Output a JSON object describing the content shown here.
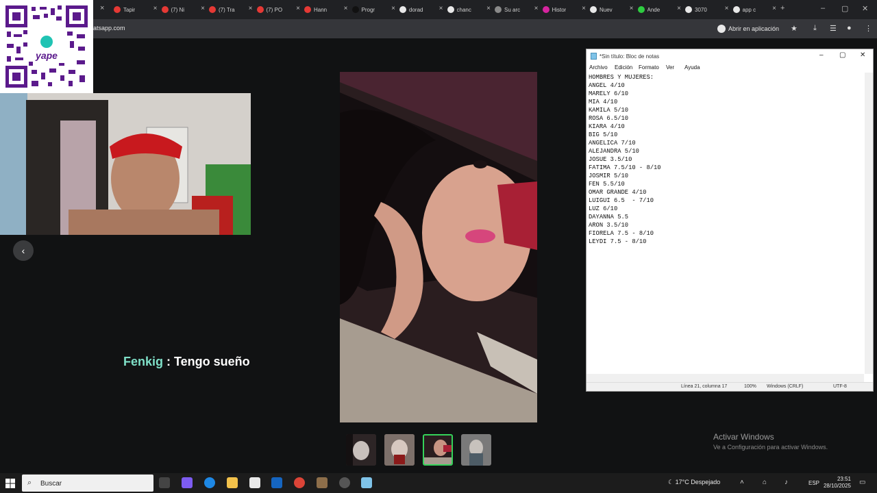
{
  "browser": {
    "tabs": [
      {
        "label": "Tapir",
        "color": "#e53935"
      },
      {
        "label": "(7) Ni",
        "color": "#e53935"
      },
      {
        "label": "(7) Tra",
        "color": "#e53935"
      },
      {
        "label": "(7) PO",
        "color": "#e53935"
      },
      {
        "label": "Hann",
        "color": "#e53935"
      },
      {
        "label": "Progr",
        "color": "#111111"
      },
      {
        "label": "dorad",
        "color": "#e8e8e8"
      },
      {
        "label": "chanc",
        "color": "#e8e8e8"
      },
      {
        "label": "Su arc",
        "color": "#8a8a8a"
      },
      {
        "label": "Histor",
        "color": "#d6249f"
      },
      {
        "label": "Nuev",
        "color": "#e8e8e8"
      },
      {
        "label": "Ande",
        "color": "#2ecc40"
      },
      {
        "label": "3070",
        "color": "#e8e8e8"
      },
      {
        "label": "app c",
        "color": "#e8e8e8"
      }
    ],
    "url": "atsapp.com",
    "open_in_app": "Abrir en aplicación"
  },
  "stream": {
    "qr_label": "yape",
    "chat_user": "Fenkig",
    "chat_message": " : Tengo sueño"
  },
  "notepad": {
    "title": "*Sin título: Bloc de notas",
    "menu": [
      "Archivo",
      "Edición",
      "Formato",
      "Ver",
      "Ayuda"
    ],
    "lines": [
      "HOMBRES Y MUJERES:",
      "ANGEL 4/10",
      "MARELY 6/10",
      "MIA 4/10",
      "KAMILA 5/10",
      "ROSA 6.5/10",
      "KIARA 4/10",
      "BIG 5/10",
      "ANGELICA 7/10",
      "ALEJANDRA 5/10",
      "JOSUE 3.5/10",
      "FATIMA 7.5/10 - 8/10",
      "JOSMIR 5/10",
      "FEN 5.5/10",
      "OMAR GRANDE 4/10",
      "LUIGUI 6.5  - 7/10",
      "LUZ 6/10",
      "DAYANNA 5.5",
      "ARON 3.5/10",
      "FIORELA 7.5 - 8/10",
      "LEYDI 7.5 - 8/10"
    ],
    "status": {
      "position": "Línea 21, columna 17",
      "zoom": "100%",
      "line_ending": "Windows (CRLF)",
      "encoding": "UTF-8"
    }
  },
  "activation": {
    "title": "Activar Windows",
    "subtitle": "Ve a Configuración para activar Windows."
  },
  "taskbar": {
    "search": "Buscar",
    "weather": "17°C  Despejado",
    "language": "ESP",
    "time": "23:51",
    "date": "28/10/2025"
  }
}
